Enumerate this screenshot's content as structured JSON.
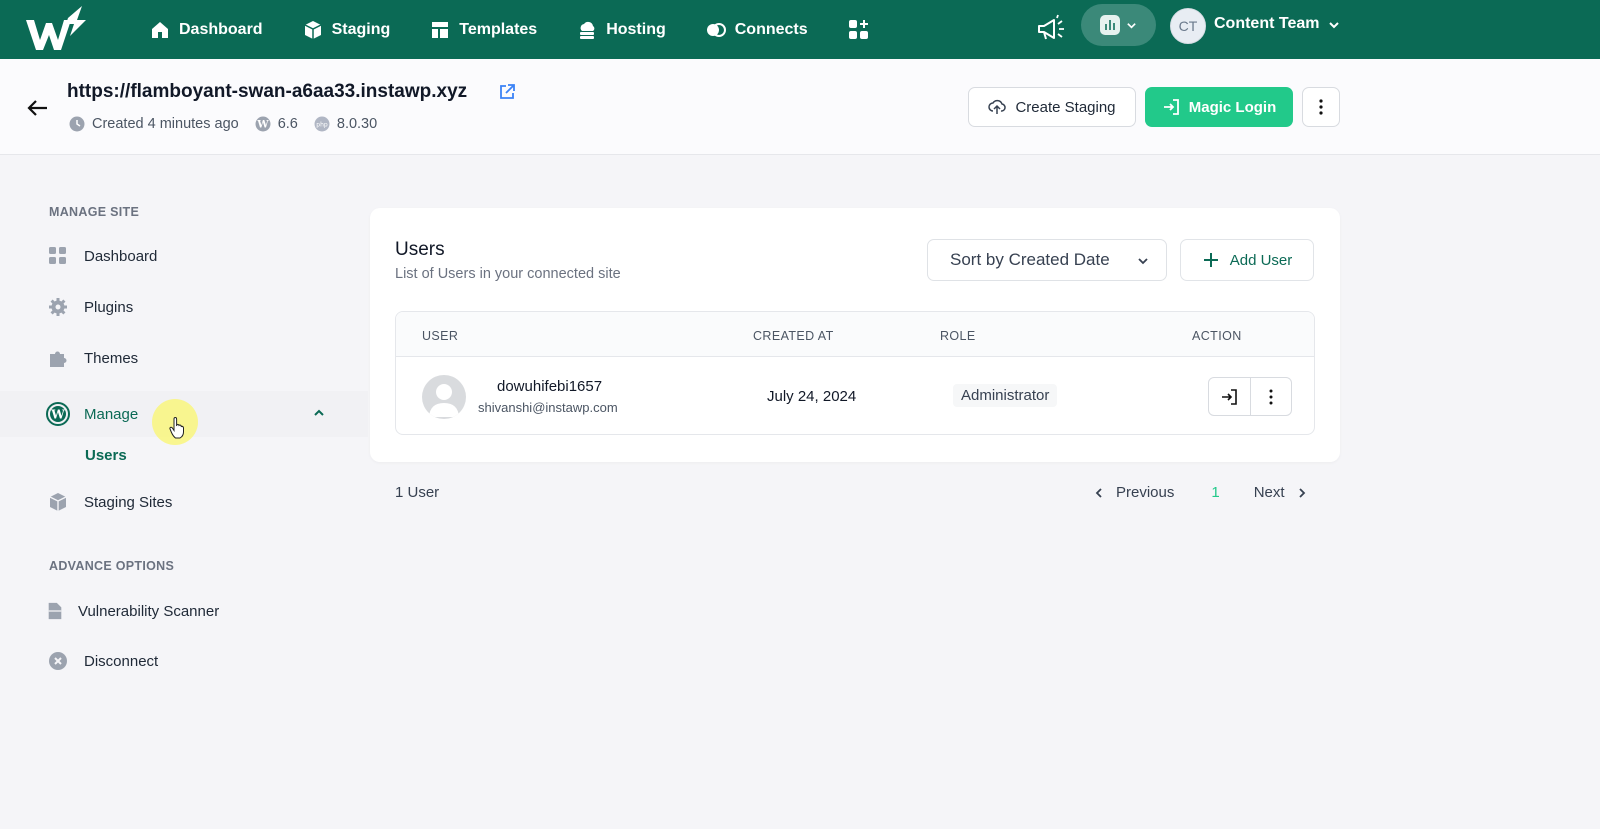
{
  "topnav": {
    "items": [
      {
        "label": "Dashboard",
        "icon": "home-icon"
      },
      {
        "label": "Staging",
        "icon": "cube-icon"
      },
      {
        "label": "Templates",
        "icon": "template-icon"
      },
      {
        "label": "Hosting",
        "icon": "cloud-icon"
      },
      {
        "label": "Connects",
        "icon": "toggle-icon"
      }
    ],
    "user": {
      "initials": "CT",
      "name": "Content Team"
    }
  },
  "site": {
    "url": "https://flamboyant-swan-a6aa33.instawp.xyz",
    "created": "Created 4 minutes ago",
    "wp_version": "6.6",
    "php_version": "8.0.30",
    "create_staging_label": "Create Staging",
    "magic_login_label": "Magic Login"
  },
  "sidebar": {
    "manage_site_title": "MANAGE SITE",
    "items": [
      {
        "label": "Dashboard"
      },
      {
        "label": "Plugins"
      },
      {
        "label": "Themes"
      },
      {
        "label": "Manage"
      },
      {
        "label": "Staging Sites"
      }
    ],
    "sub_item": "Users",
    "advance_title": "ADVANCE OPTIONS",
    "advance_items": [
      {
        "label": "Vulnerability Scanner"
      },
      {
        "label": "Disconnect"
      }
    ]
  },
  "users": {
    "title": "Users",
    "subtitle": "List of Users in your connected site",
    "sort_label": "Sort by Created Date",
    "add_label": "Add User",
    "columns": [
      "USER",
      "CREATED AT",
      "ROLE",
      "ACTION"
    ],
    "rows": [
      {
        "username": "dowuhifebi1657",
        "email": "shivanshi@instawp.com",
        "created": "July 24, 2024",
        "role": "Administrator"
      }
    ],
    "count": "1 User",
    "pager": {
      "prev": "Previous",
      "page": "1",
      "next": "Next"
    }
  },
  "colors": {
    "brand": "#0b6a55",
    "accent": "#22c98a"
  }
}
